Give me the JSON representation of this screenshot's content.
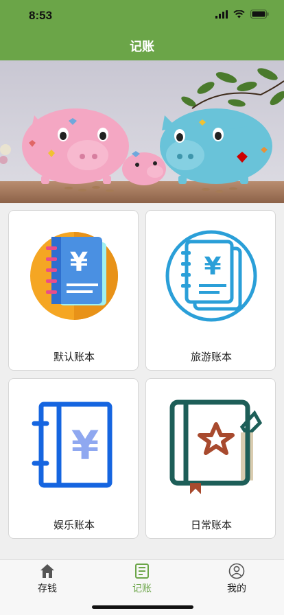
{
  "status_bar": {
    "time": "8:53"
  },
  "header": {
    "title": "记账"
  },
  "books": [
    {
      "label": "默认账本",
      "icon": "ledger-yen-orange-circle-icon"
    },
    {
      "label": "旅游账本",
      "icon": "ledger-yen-outline-blue-icon"
    },
    {
      "label": "娱乐账本",
      "icon": "notebook-yen-blue-icon"
    },
    {
      "label": "日常账本",
      "icon": "notebook-star-green-icon"
    }
  ],
  "tabs": [
    {
      "label": "存钱",
      "icon": "home-icon",
      "active": false
    },
    {
      "label": "记账",
      "icon": "ledger-icon",
      "active": true
    },
    {
      "label": "我的",
      "icon": "user-icon",
      "active": false
    }
  ],
  "colors": {
    "accent": "#6ba548",
    "tab_active": "#6ba548"
  }
}
